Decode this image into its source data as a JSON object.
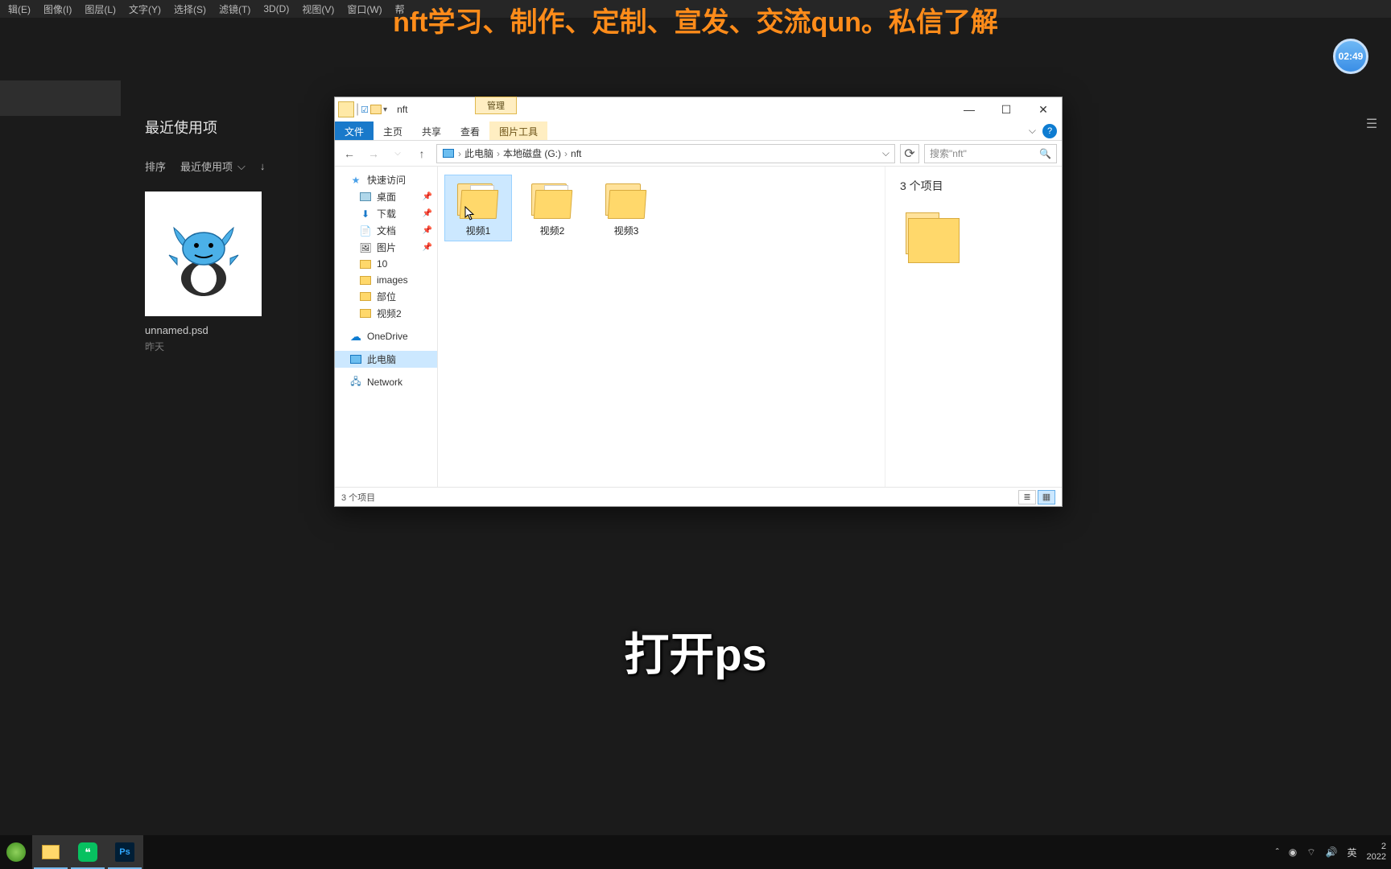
{
  "ps": {
    "menu": [
      "辑(E)",
      "图像(I)",
      "图层(L)",
      "文字(Y)",
      "选择(S)",
      "滤镜(T)",
      "3D(D)",
      "视图(V)",
      "窗口(W)",
      "帮"
    ],
    "home_title": "最近使用项",
    "sort_label": "排序",
    "sort_value": "最近使用项",
    "download_icon": "↓",
    "thumb_name": "unnamed.psd",
    "thumb_date": "昨天"
  },
  "timer": {
    "value": "02:49"
  },
  "overlay_top": "nft学习、制作、定制、宣发、交流qun。私信了解",
  "subtitle": "打开ps",
  "explorer": {
    "context_tab": "管理",
    "context_sub": "图片工具",
    "title": "nft",
    "tabs": {
      "file": "文件",
      "home": "主页",
      "share": "共享",
      "view": "查看"
    },
    "breadcrumb": [
      "此电脑",
      "本地磁盘 (G:)",
      "nft"
    ],
    "search_placeholder": "搜索\"nft\"",
    "nav": {
      "quick": "快速访问",
      "quick_items": [
        "桌面",
        "下载",
        "文档",
        "图片",
        "10",
        "images",
        "部位",
        "视频2"
      ],
      "pinned": [
        true,
        true,
        true,
        true,
        false,
        false,
        false,
        false
      ],
      "onedrive": "OneDrive",
      "thispc": "此电脑",
      "network": "Network"
    },
    "folders": [
      {
        "name": "视频1",
        "has_thumb": true,
        "selected": true
      },
      {
        "name": "视频2",
        "has_thumb": true,
        "selected": false
      },
      {
        "name": "视频3",
        "has_thumb": false,
        "selected": false
      }
    ],
    "sidepane_title": "3 个项目",
    "status": "3 个项目"
  },
  "taskbar": {
    "tray_lang": "英",
    "clock_time": "2",
    "clock_date": "2022"
  }
}
